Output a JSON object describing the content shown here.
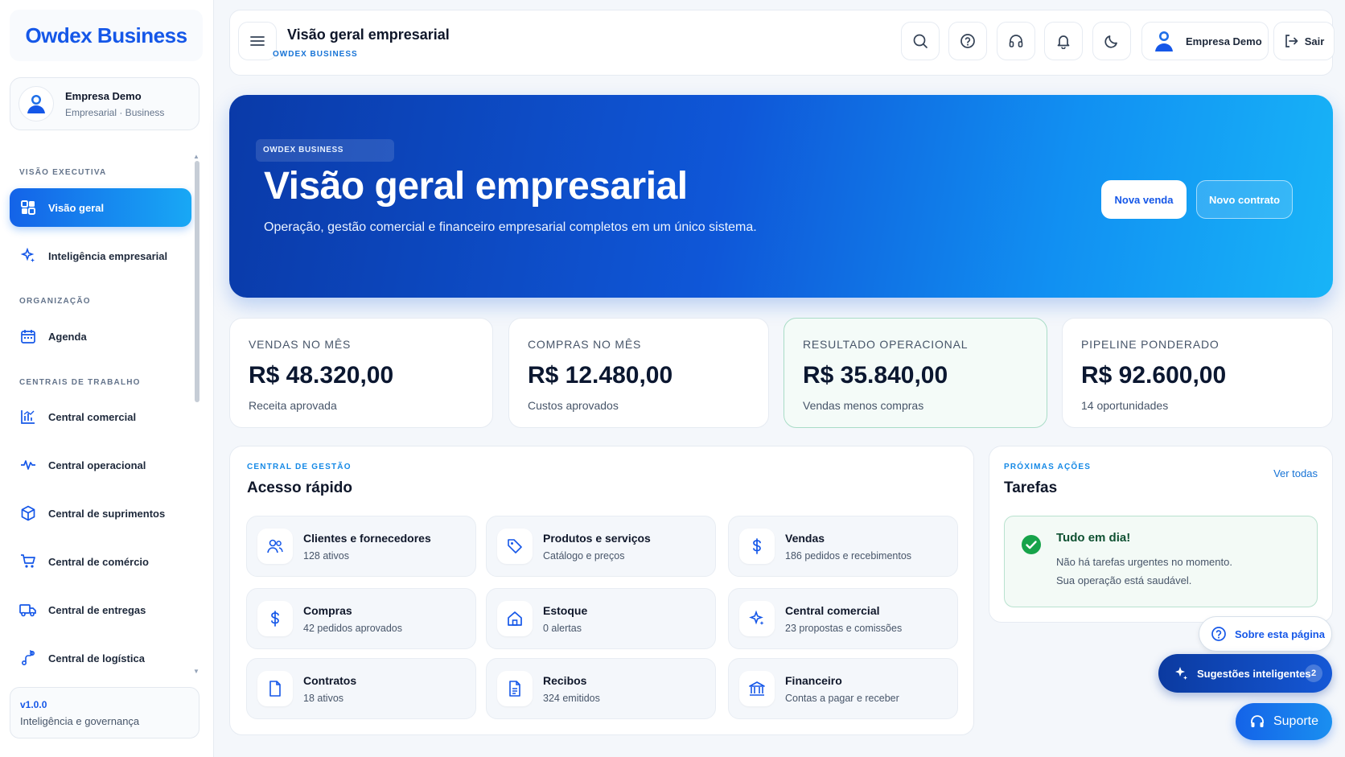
{
  "sidebar": {
    "logo": "Owdex Business",
    "profile": {
      "name": "Empresa Demo",
      "plan": "Empresarial · Business"
    },
    "sections": {
      "executive": "VISÃO EXECUTIVA",
      "organization": "ORGANIZAÇÃO",
      "work_centers": "CENTRAIS DE TRABALHO"
    },
    "items": [
      {
        "label": "Visão geral",
        "icon": "dashboard-grid-icon",
        "active": true
      },
      {
        "label": "Inteligência empresarial",
        "icon": "sparkles-icon"
      },
      {
        "label": "Agenda",
        "icon": "calendar-icon"
      },
      {
        "label": "Central comercial",
        "icon": "chart-icon"
      },
      {
        "label": "Central operacional",
        "icon": "activity-pulse-icon"
      },
      {
        "label": "Central de suprimentos",
        "icon": "box-icon"
      },
      {
        "label": "Central de comércio",
        "icon": "cart-icon"
      },
      {
        "label": "Central de entregas",
        "icon": "truck-icon"
      },
      {
        "label": "Central de logística",
        "icon": "route-icon"
      }
    ],
    "version": {
      "number": "v1.0.0",
      "caption": "Inteligência e governança"
    }
  },
  "header": {
    "title": "Visão geral empresarial",
    "subtitle": "OWDEX BUSINESS",
    "user": "Empresa Demo",
    "logout": "Sair",
    "icons": [
      "search-icon",
      "help-icon",
      "headset-icon",
      "bell-icon",
      "moon-icon"
    ]
  },
  "hero": {
    "badge": "OWDEX BUSINESS",
    "title": "Visão geral empresarial",
    "description": "Operação, gestão comercial e financeiro empresarial completos em um único sistema.",
    "primary_button": "Nova venda",
    "secondary_button": "Novo contrato"
  },
  "kpis": [
    {
      "label": "VENDAS NO MÊS",
      "value": "R$ 48.320,00",
      "sub": "Receita aprovada"
    },
    {
      "label": "COMPRAS NO MÊS",
      "value": "R$ 12.480,00",
      "sub": "Custos aprovados"
    },
    {
      "label": "RESULTADO OPERACIONAL",
      "value": "R$ 35.840,00",
      "sub": "Vendas menos compras"
    },
    {
      "label": "PIPELINE PONDERADO",
      "value": "R$ 92.600,00",
      "sub": "14 oportunidades"
    }
  ],
  "quick_access": {
    "kicker": "CENTRAL DE GESTÃO",
    "title": "Acesso rápido",
    "tiles": [
      {
        "title": "Clientes e fornecedores",
        "sub": "128 ativos",
        "icon": "users-icon"
      },
      {
        "title": "Produtos e serviços",
        "sub": "Catálogo e preços",
        "icon": "tag-icon"
      },
      {
        "title": "Vendas",
        "sub": "186 pedidos e recebimentos",
        "icon": "dollar-icon"
      },
      {
        "title": "Compras",
        "sub": "42 pedidos aprovados",
        "icon": "dollar-icon"
      },
      {
        "title": "Estoque",
        "sub": "0 alertas",
        "icon": "home-icon"
      },
      {
        "title": "Central comercial",
        "sub": "23 propostas e comissões",
        "icon": "sparkles-icon"
      },
      {
        "title": "Contratos",
        "sub": "18 ativos",
        "icon": "file-icon"
      },
      {
        "title": "Recibos",
        "sub": "324 emitidos",
        "icon": "file-text-icon"
      },
      {
        "title": "Financeiro",
        "sub": "Contas a pagar e receber",
        "icon": "bank-icon"
      }
    ]
  },
  "tasks": {
    "kicker": "PRÓXIMAS AÇÕES",
    "title": "Tarefas",
    "link": "Ver todas",
    "status_title": "Tudo em dia!",
    "status_line1": "Não há tarefas urgentes no momento.",
    "status_line2": "Sua operação está saudável."
  },
  "floating": {
    "about": "Sobre esta página",
    "smart": "Sugestões inteligentes",
    "smart_count": "2",
    "support": "Suporte"
  },
  "colors": {
    "primary": "#1557e8",
    "accent": "#18a8f5",
    "success": "#16a34a"
  }
}
